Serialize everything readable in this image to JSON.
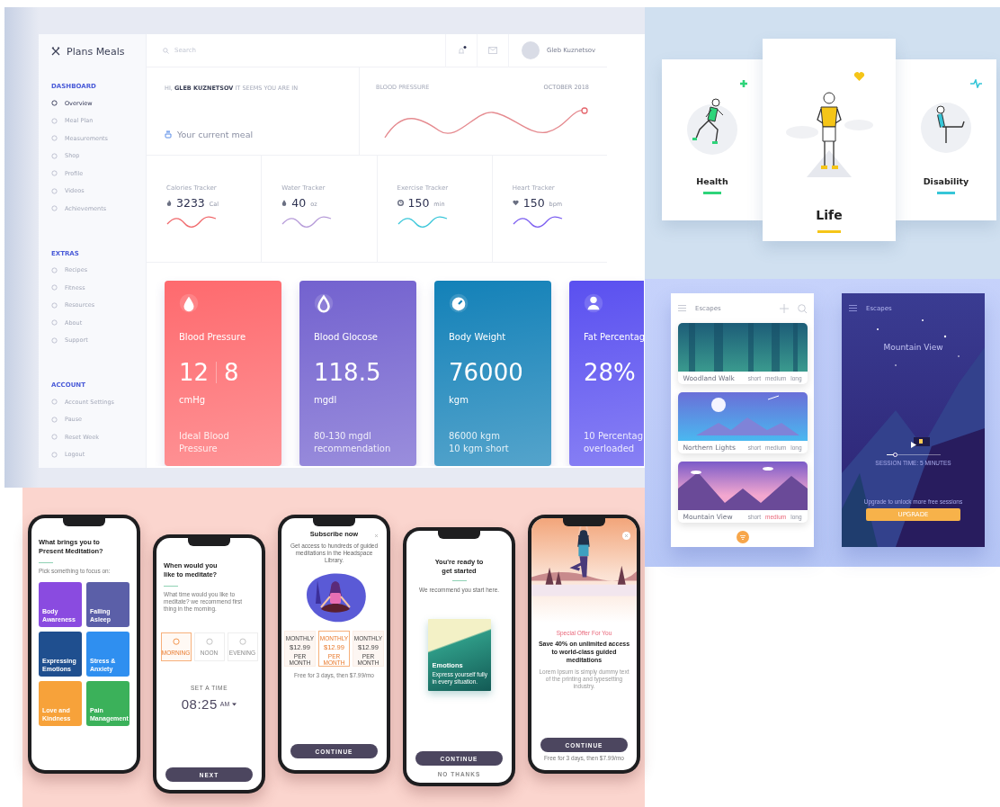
{
  "dashboard": {
    "brand": "Plans Meals",
    "sidebar": [
      {
        "heading": "DASHBOARD",
        "items": [
          {
            "label": "Overview",
            "selected": true
          },
          {
            "label": "Meal Plan",
            "selected": false
          },
          {
            "label": "Measurements",
            "selected": false
          },
          {
            "label": "Shop",
            "selected": false
          },
          {
            "label": "Profile",
            "selected": false
          },
          {
            "label": "Videos",
            "selected": false
          },
          {
            "label": "Achievements",
            "selected": false
          }
        ]
      },
      {
        "heading": "EXTRAS",
        "items": [
          {
            "label": "Recipes",
            "selected": false
          },
          {
            "label": "Fitness",
            "selected": false
          },
          {
            "label": "Resources",
            "selected": false
          },
          {
            "label": "About",
            "selected": false
          },
          {
            "label": "Support",
            "selected": false
          }
        ]
      },
      {
        "heading": "ACCOUNT",
        "items": [
          {
            "label": "Account Settings",
            "selected": false
          },
          {
            "label": "Pause",
            "selected": false
          },
          {
            "label": "Reset Week",
            "selected": false
          },
          {
            "label": "Logout",
            "selected": false
          }
        ]
      }
    ],
    "search": {
      "placeholder": "Search"
    },
    "has_unread": true,
    "user_name": "Gleb Kuznetsov",
    "greeting": "HI, **GLEB KUZNETSOV** IT SEEMS YOU ARE IN",
    "current_meal": "Your current meal",
    "blood_pressure": {
      "title": "BLOOD PRESSURE",
      "period": "OCTOBER 2018"
    },
    "trackers": [
      {
        "kind": "calories",
        "label": "Calories Tracker",
        "value": "3233",
        "unit": "Cal",
        "color": "#f0676a"
      },
      {
        "kind": "water",
        "label": "Water Tracker",
        "value": "40",
        "unit": "oz",
        "color": "#b59ad8"
      },
      {
        "kind": "exercise",
        "label": "Exercise Tracker",
        "value": "150",
        "unit": "min",
        "color": "#38c6d9"
      },
      {
        "kind": "heart",
        "label": "Heart Tracker",
        "value": "150",
        "unit": "bpm",
        "color": "#7a5cf0"
      }
    ],
    "cards": [
      {
        "kind": "pressure",
        "title": "Blood Pressure",
        "values": [
          "12",
          "8"
        ],
        "unit": "cmHg",
        "note": [
          "Ideal Blood",
          "Pressure"
        ],
        "color": "#fe6a6e"
      },
      {
        "kind": "glucose",
        "title": "Blood Glocose",
        "values": [
          "118.5"
        ],
        "unit": "mgdl",
        "note": [
          "80-130 mgdl",
          "recommendation"
        ],
        "color": "#7362cf"
      },
      {
        "kind": "weight",
        "title": "Body Weight",
        "values": [
          "76000"
        ],
        "unit": "kgm",
        "note": [
          "86000 kgm",
          "10 kgm short"
        ],
        "color": "#1381b8"
      },
      {
        "kind": "fat",
        "title": "Fat Percentag",
        "values": [
          "28%"
        ],
        "note": [
          "10 Percentag",
          "overloaded"
        ],
        "color": "#5a50f0"
      }
    ]
  },
  "plans": [
    {
      "kind": "running",
      "label": "Health",
      "selected": false,
      "color": "#2ed47a"
    },
    {
      "kind": "standing",
      "label": "Life",
      "selected": true,
      "color": "#f5c518"
    },
    {
      "kind": "exercising",
      "label": "Disability",
      "selected": false,
      "color": "#36c6d8"
    }
  ],
  "escapes_list": {
    "title": "Escapes",
    "items": [
      {
        "kind": "forest",
        "title": "Woodland Walk",
        "options": [
          {
            "label": "short",
            "selected": false
          },
          {
            "label": "medium",
            "selected": false
          },
          {
            "label": "long",
            "selected": false
          }
        ]
      },
      {
        "kind": "night",
        "title": "Northern Lights",
        "options": [
          {
            "label": "short",
            "selected": false
          },
          {
            "label": "medium",
            "selected": false
          },
          {
            "label": "long",
            "selected": false
          }
        ]
      },
      {
        "kind": "sunset",
        "title": "Mountain View",
        "options": [
          {
            "label": "short",
            "selected": false
          },
          {
            "label": "medium",
            "selected": true
          },
          {
            "label": "long",
            "selected": false
          }
        ]
      }
    ]
  },
  "escapes_player": {
    "title": "Escapes",
    "scene_title": "Mountain View",
    "level": 0.18,
    "session": "SESSION TIME: 5 MINUTES",
    "upgrade_note": "Upgrade to unlock more free sessions",
    "button": "UPGRADE"
  },
  "meditation_phones": [
    {
      "kind": "topics",
      "title": "What brings you to Present Meditation?",
      "hint": "Pick something to focus on:",
      "topics": [
        {
          "label": "Body Awareness",
          "color": "#8a4be0"
        },
        {
          "label": "Falling Asleep",
          "color": "#5b5fa8"
        },
        {
          "label": "Expressing Emotions",
          "color": "#1f4f8f"
        },
        {
          "label": "Stress & Anxiety",
          "color": "#2f8ff0"
        },
        {
          "label": "Love and Kindness",
          "color": "#f7a23a"
        },
        {
          "label": "Pain Management",
          "color": "#3bb15a"
        }
      ]
    },
    {
      "kind": "time",
      "title": "When would you like to meditate?",
      "text": "What time would you like to meditate? we recommend first thing in the morning.",
      "options": [
        {
          "label": "MORNING",
          "selected": true
        },
        {
          "label": "NOON",
          "selected": false
        },
        {
          "label": "EVENING",
          "selected": false
        }
      ],
      "set_label": "SET A TIME",
      "time": "08:25",
      "meridiem": "AM",
      "button": "NEXT"
    },
    {
      "kind": "subscribe",
      "title": "Subscribe now",
      "text": "Get access to hundreds of guided meditations in the Headspace Library.",
      "plans": [
        {
          "period": "MONTHLY",
          "price": "$12.99",
          "per": "PER MONTH",
          "selected": false
        },
        {
          "period": "MONTHLY",
          "price": "$12.99",
          "per": "PER MONTH",
          "selected": true
        },
        {
          "period": "MONTHLY",
          "price": "$12.99",
          "per": "PER MONTH",
          "selected": false
        }
      ],
      "fine_print": "Free for 3 days, then $7.99/mo",
      "button": "CONTINUE"
    },
    {
      "kind": "ready",
      "title": "You're ready to get started",
      "text": "We recommend you start here.",
      "card_title": "Emotions",
      "card_text": "Express yourself fully in every situation.",
      "button": "CONTINUE",
      "secondary": "NO THANKS"
    },
    {
      "kind": "offer",
      "eyebrow": "Special Offer For You",
      "title": "Save 40% on unlimited access to world-class guided meditations",
      "text": "Lorem Ipsum is simply dummy text of the printing and typesetting industry.",
      "button": "CONTINUE",
      "fine_print": "Free for 3 days, then $7.99/mo"
    }
  ]
}
